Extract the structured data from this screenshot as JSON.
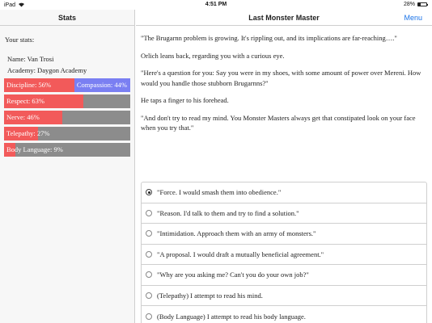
{
  "status_bar": {
    "carrier": "iPad",
    "time": "4:51 PM",
    "battery": "28%",
    "battery_level": 0.28
  },
  "sidebar": {
    "title": "Stats",
    "your_stats": "Your stats:",
    "name": "Name: Van Trosi",
    "academy": "Academy: Daygon Academy",
    "stats": [
      {
        "label": "Discipline: 56%",
        "value": 56,
        "right_label": "Compassion: 44%"
      },
      {
        "label": "Respect: 63%",
        "value": 63
      },
      {
        "label": "Nerve: 46%",
        "value": 46
      },
      {
        "label": "Telepathy: 27%",
        "value": 27
      },
      {
        "label": "Body Language: 9%",
        "value": 9
      }
    ],
    "colors": {
      "fill": "#f25a5a",
      "empty": "#8c8c8c",
      "opposed": "#7a7ff2"
    }
  },
  "main": {
    "title": "Last Monster Master",
    "menu": "Menu",
    "paragraphs": [
      "\"The Brugarnn problem is growing. It's rippling out, and its implications are far-reaching….\"",
      "Orlich leans back, regarding you with a curious eye.",
      "\"Here's a question for you: Say you were in my shoes, with some amount of power over Mereni. How would you handle those stubborn Brugarnns?\"",
      "He taps a finger to his forehead.",
      "\"And don't try to read my mind. You Monster Masters always get that constipated look on your face when you try that.\""
    ],
    "choices": [
      "\"Force. I would smash them into obedience.\"",
      "\"Reason. I'd talk to them and try to find a solution.\"",
      "\"Intimidation. Approach them with an army of monsters.\"",
      "\"A proposal. I would draft a mutually beneficial agreement.\"",
      "\"Why are you asking me? Can't you do your own job?\"",
      "(Telepathy) I attempt to read his mind.",
      "(Body Language) I attempt to read his body language."
    ],
    "selected_choice": 0,
    "accent": "#1a73e8"
  }
}
